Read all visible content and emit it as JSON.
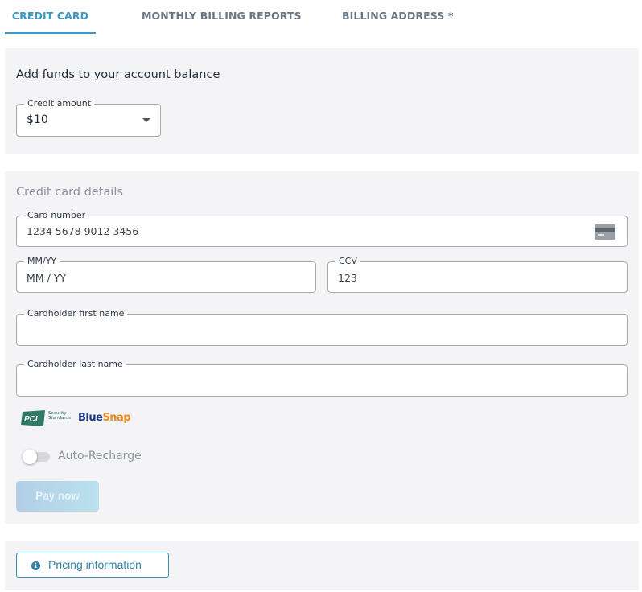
{
  "tabs": [
    {
      "label": "CREDIT CARD",
      "active": true
    },
    {
      "label": "MONTHLY BILLING REPORTS",
      "active": false
    },
    {
      "label": "BILLING ADDRESS *",
      "active": false
    }
  ],
  "funds": {
    "title": "Add funds to your account balance",
    "credit_amount": {
      "label": "Credit amount",
      "value": "$10"
    }
  },
  "card_details": {
    "title": "Credit card details",
    "card_number": {
      "label": "Card number",
      "placeholder": "1234 5678 9012 3456"
    },
    "expiry": {
      "label": "MM/YY",
      "placeholder": "MM / YY"
    },
    "ccv": {
      "label": "CCV",
      "placeholder": "123"
    },
    "first_name": {
      "label": "Cardholder first name",
      "value": ""
    },
    "last_name": {
      "label": "Cardholder last name",
      "value": ""
    },
    "pci_text": [
      "Security",
      "Standards"
    ],
    "pci_logo_text": "PCI",
    "bluesnap": {
      "part1": "Blue",
      "part2": "Snap"
    },
    "auto_recharge": {
      "label": "Auto-Recharge",
      "enabled": false
    },
    "pay_button": "Pay now"
  },
  "pricing": {
    "button": "Pricing information",
    "icon": "info-icon"
  },
  "colors": {
    "accent": "#3d97c4",
    "panel_bg": "#f4f4f6",
    "bluesnap_blue": "#1c3a8a",
    "bluesnap_orange": "#f08a1c"
  }
}
